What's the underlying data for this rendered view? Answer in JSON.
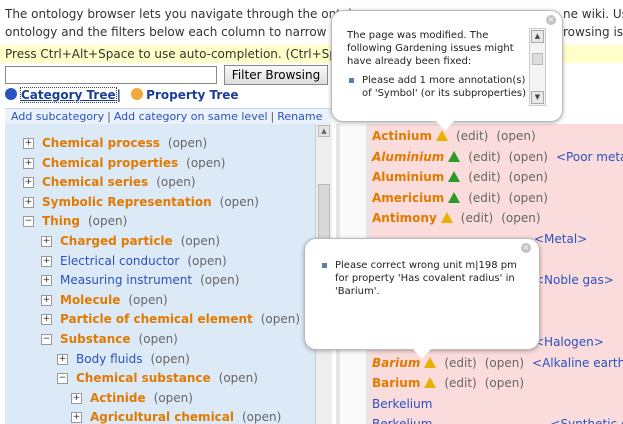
{
  "intro": {
    "line1": "The ontology browser lets you navigate through the ontol",
    "line1_right": "ne wiki. Use",
    "line2": "ontology and the filters below each column to narrow dov",
    "line2_right": "rowsing is",
    "hint": "Press Ctrl+Alt+Space to use auto-completion. (Ctrl+Spa"
  },
  "filter": {
    "value": "",
    "button_label": "Filter Browsing"
  },
  "tabs": {
    "category": "Category Tree",
    "property": "Property Tree",
    "separator": "|"
  },
  "toolbar": {
    "add_subcategory": "Add subcategory",
    "add_same_level": "Add category on same level",
    "rename": "Rename",
    "sep": "|"
  },
  "tree": {
    "open_label": "(open)",
    "items": [
      {
        "label": "Chemical process",
        "style": "orange"
      },
      {
        "label": "Chemical properties",
        "style": "orange"
      },
      {
        "label": "Chemical series",
        "style": "orange"
      },
      {
        "label": "Symbolic Representation",
        "style": "orange"
      },
      {
        "label": "Thing",
        "style": "orange",
        "expanded": true
      },
      {
        "label": "Charged particle",
        "style": "orange"
      },
      {
        "label": "Electrical conductor",
        "style": "blue"
      },
      {
        "label": "Measuring instrument",
        "style": "blue"
      },
      {
        "label": "Molecule",
        "style": "orange"
      },
      {
        "label": "Particle of chemical element",
        "style": "orange"
      },
      {
        "label": "Substance",
        "style": "orange",
        "expanded": true
      },
      {
        "label": "Body fluids",
        "style": "blue"
      },
      {
        "label": "Chemical substance",
        "style": "orange",
        "expanded": true
      },
      {
        "label": "Actinide",
        "style": "orange"
      },
      {
        "label": "Agricultural chemical",
        "style": "orange"
      }
    ]
  },
  "instances": {
    "edit_label": "(edit)",
    "open_label": "(open)",
    "items": [
      {
        "name": "Actinium",
        "icon": "warning",
        "ptype": ""
      },
      {
        "name": "Aluminium",
        "icon": "ok",
        "ptype": "<Poor metal>",
        "italic": true
      },
      {
        "name": "Aluminium",
        "icon": "ok",
        "ptype": ""
      },
      {
        "name": "Americium",
        "icon": "ok",
        "ptype": ""
      },
      {
        "name": "Antimony",
        "icon": "warning",
        "ptype": ""
      },
      {
        "name": "",
        "icon": "",
        "ptype": "<Metal>"
      },
      {
        "name": "",
        "icon": "",
        "ptype": ""
      },
      {
        "name": "",
        "icon": "",
        "ptype": "<Noble gas>"
      },
      {
        "name": "",
        "icon": "",
        "ptype": ""
      },
      {
        "name": "",
        "icon": "",
        "ptype": ""
      },
      {
        "name": "",
        "icon": "",
        "ptype": "<Halogen>"
      },
      {
        "name": "Barium",
        "icon": "warning",
        "ptype": "<Alkaline earth",
        "italic": true
      },
      {
        "name": "Barium",
        "icon": "warning",
        "ptype": ""
      },
      {
        "name": "Berkelium",
        "icon": "",
        "ptype": "",
        "blue": true
      },
      {
        "name": "Berkelium",
        "icon": "",
        "ptype": "<Synthetic elem",
        "blue": true
      }
    ]
  },
  "popup1": {
    "title": "The page was modified. The following Gardening issues might have already been fixed:",
    "issue": "Please add 1 more annotation(s) of 'Symbol' (or its subproperties) to 'Aluminium'."
  },
  "popup2": {
    "issue": "Please correct wrong unit m|198 pm for property 'Has covalent radius' in 'Barium'."
  },
  "colors": {
    "accent": "#e07a00",
    "link": "#2a52be",
    "tree_bg": "#dce9f7",
    "instance_bg": "#fbdcdc",
    "hint_bg": "#ffffc8"
  }
}
